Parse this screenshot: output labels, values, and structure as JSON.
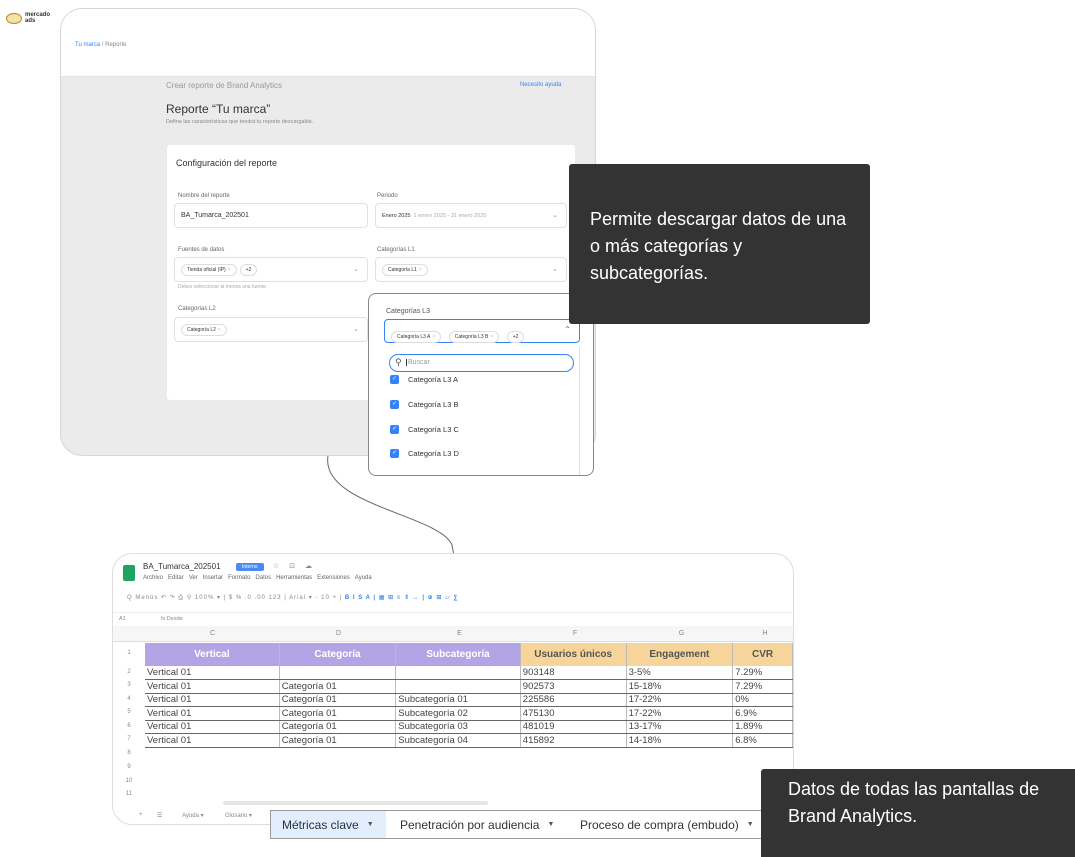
{
  "logo": {
    "line1": "mercado",
    "line2": "ads"
  },
  "report_form": {
    "breadcrumb": {
      "link": "Tu marca",
      "sep": "/",
      "current": "Reporte"
    },
    "eyebrow": "Crear reporte de Brand Analytics",
    "help_link": "Necesito ayuda",
    "title": "Reporte “Tu marca”",
    "subtitle": "Define las características que tendrá tu reporte descargable.",
    "config_title": "Configuración del reporte",
    "fields": {
      "nombre": {
        "label": "Nombre del reporte",
        "value": "BA_Tumarca_202501"
      },
      "periodo": {
        "label": "Periodo",
        "value": "Enero 2025",
        "hint": "1 enero 2025 - 31 enero 2025"
      },
      "fuentes": {
        "label": "Fuentes de datos",
        "chip": "Tienda oficial (IP)",
        "more": "+2",
        "help": "Debes seleccionar al menos una fuente."
      },
      "l1": {
        "label": "Categorías L1",
        "chip": "Categoría L1"
      },
      "l2": {
        "label": "Categorías L2",
        "chip": "Categoría L2"
      }
    }
  },
  "l3_dropdown": {
    "label": "Categorías L3",
    "chips": [
      "Categoría L3 A",
      "Categoría L3 B"
    ],
    "more": "+2",
    "search_placeholder": "Buscar",
    "options": [
      "Categoría L3 A",
      "Categoría L3 B",
      "Categoría L3 C",
      "Categoría L3 D"
    ]
  },
  "tooltips": {
    "top": "Permite descargar datos de una o más categorías y subcategorías.",
    "bottom": "Datos de todas las pantallas de Brand Analytics."
  },
  "sheet": {
    "file_name": "BA_Tumarca_202501",
    "badge": "Interno",
    "title_icons": "☆ ⊡ ☁",
    "menu": [
      "Archivo",
      "Editar",
      "Ver",
      "Insertar",
      "Formato",
      "Datos",
      "Herramientas",
      "Extensiones",
      "Ayuda"
    ],
    "toolbar": "Q  Menús   ↶  ↷  ⎙  ⚲  100%  ▾  |  $  %  .0  .00  123  |  Arial  ▾  -  10  +  |",
    "toolbar_tail": "B  I  S  A  |  ▦  ⊞  ≡  ⇕  ↔  |  ⊕  ⊞  ⏥  ∑",
    "cell_ref": "A1",
    "formula": "fx  Desde",
    "col_letters": [
      "C",
      "D",
      "E",
      "F",
      "G",
      "H"
    ],
    "row_numbers": [
      "1",
      "2",
      "3",
      "4",
      "5",
      "6",
      "7",
      "8",
      "9",
      "10",
      "11"
    ],
    "headers": [
      "Vertical",
      "Categoría",
      "Subcategoría",
      "Usuarios únicos",
      "Engagement",
      "CVR"
    ],
    "rows": [
      [
        "Vertical 01",
        "",
        "",
        "903148",
        "3-5%",
        "7.29%"
      ],
      [
        "Vertical 01",
        "Categoría 01",
        "",
        "902573",
        "15-18%",
        "7.29%"
      ],
      [
        "Vertical 01",
        "Categoría 01",
        "Subcategoría 01",
        "225586",
        "17-22%",
        "0%"
      ],
      [
        "Vertical 01",
        "Categoría 01",
        "Subcategoría 02",
        "475130",
        "17-22%",
        "6.9%"
      ],
      [
        "Vertical 01",
        "Categoría 01",
        "Subcategoría 03",
        "481019",
        "13-17%",
        "1.89%"
      ],
      [
        "Vertical 01",
        "Categoría 01",
        "Subcategoría 04",
        "415892",
        "14-18%",
        "6.8%"
      ]
    ],
    "footer": {
      "add": "+",
      "list": "☰",
      "sheet_a": "Ayuda  ▾",
      "sheet_b": "Glosario  ▾"
    }
  },
  "tabs": [
    {
      "label": "Métricas clave",
      "active": true
    },
    {
      "label": "Penetración por audiencia",
      "active": false
    },
    {
      "label": "Proceso de compra (embudo)",
      "active": false
    }
  ],
  "colors": {
    "accent": "#3483fa",
    "header_purple": "#b3a4e6",
    "header_yellow": "#f7d59a",
    "tooltip_bg": "#333333"
  }
}
